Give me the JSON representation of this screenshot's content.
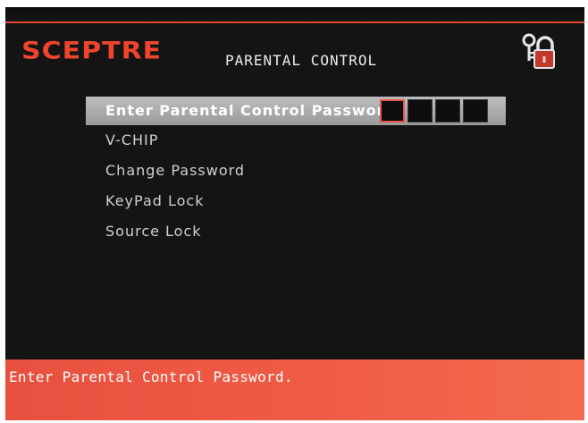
{
  "brand": {
    "logo_text": "SCEPTRE",
    "accent_color": "#e8443a"
  },
  "header": {
    "title": "PARENTAL CONTROL",
    "icon": "key-lock-icon"
  },
  "menu": {
    "items": [
      {
        "label": "Enter Parental Control Password",
        "selected": true
      },
      {
        "label": "V-CHIP",
        "selected": false
      },
      {
        "label": "Change Password",
        "selected": false
      },
      {
        "label": "KeyPad Lock",
        "selected": false
      },
      {
        "label": "Source Lock",
        "selected": false
      }
    ],
    "password": {
      "digit_count": 4,
      "entered_digits": 0,
      "active_index": 0
    }
  },
  "status_bar": {
    "message": "Enter Parental Control Password."
  }
}
